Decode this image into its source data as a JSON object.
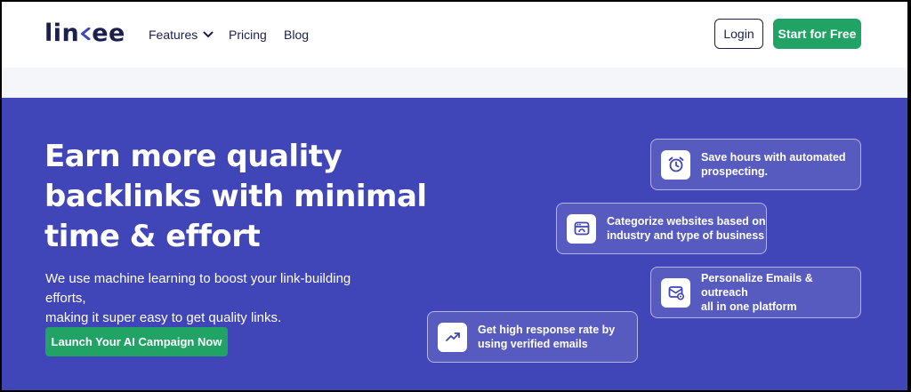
{
  "header": {
    "logo_text": [
      "lin",
      "ee"
    ],
    "nav": [
      {
        "label": "Features",
        "icon": "chevron-down-icon"
      },
      {
        "label": "Pricing"
      },
      {
        "label": "Blog"
      }
    ],
    "login_label": "Login",
    "start_label": "Start for Free"
  },
  "hero": {
    "headline": [
      "Earn more quality",
      "backlinks with minimal",
      "time & effort"
    ],
    "subtitle": [
      "We use machine learning to boost your link-building efforts,",
      "making it super easy to get quality links."
    ],
    "cta_label": "Launch Your AI Campaign Now"
  },
  "features": [
    {
      "icon": "alarm-clock-icon",
      "lines": [
        "Save hours with automated",
        "prospecting."
      ]
    },
    {
      "icon": "browser-window-icon",
      "lines": [
        "Categorize websites based on",
        "industry and type of business"
      ]
    },
    {
      "icon": "email-settings-icon",
      "lines": [
        "Personalize Emails & outreach",
        "all in one platform"
      ]
    },
    {
      "icon": "trending-up-icon",
      "lines": [
        "Get high response rate by",
        "using verified emails"
      ]
    }
  ],
  "colors": {
    "brand_dark": "#1b1f4b",
    "accent_green": "#21a366",
    "hero_bg": "#4045b7"
  }
}
